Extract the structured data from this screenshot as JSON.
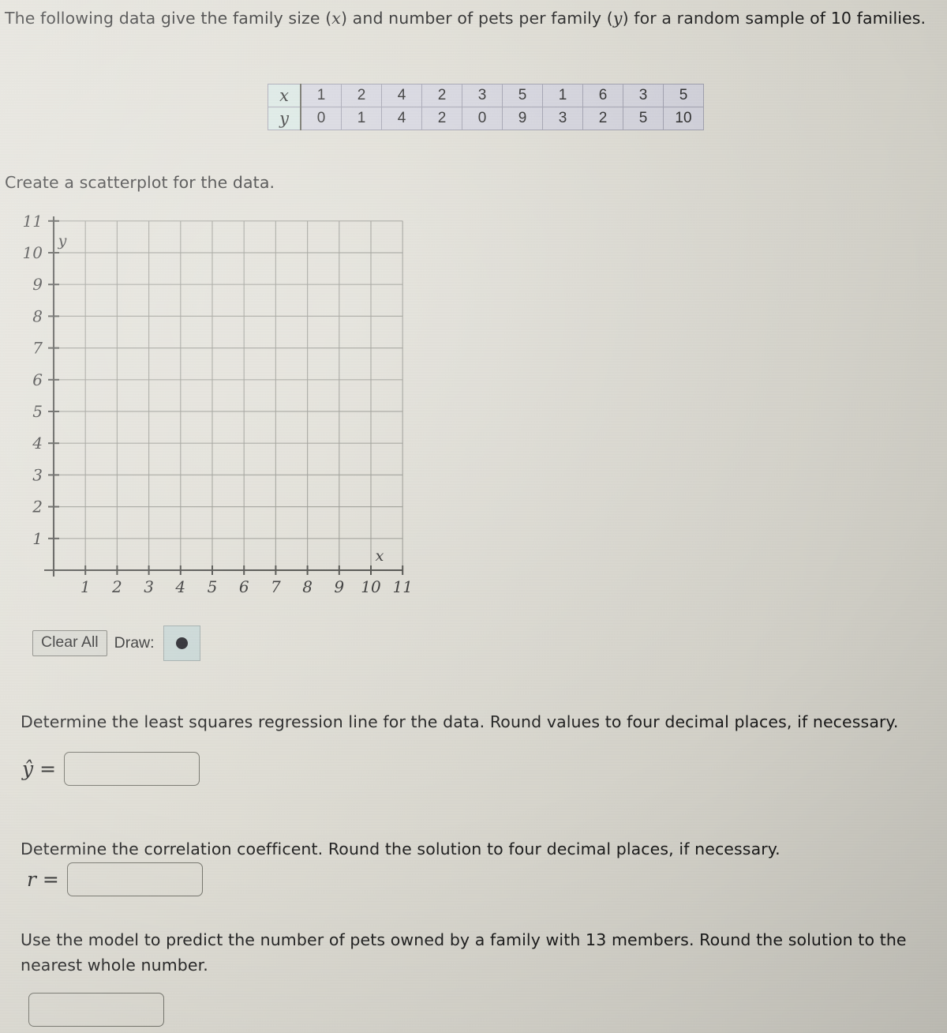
{
  "intro": {
    "text_before_x": "The following data give the family size (",
    "var_x": "x",
    "text_mid": ") and number of pets per family (",
    "var_y": "y",
    "text_after": ") for a random sample of 10 families."
  },
  "data_table": {
    "row_x_label": "x",
    "row_y_label": "y",
    "x_values": [
      "1",
      "2",
      "4",
      "2",
      "3",
      "5",
      "1",
      "6",
      "3",
      "5"
    ],
    "y_values": [
      "0",
      "1",
      "4",
      "2",
      "0",
      "9",
      "3",
      "2",
      "5",
      "10"
    ]
  },
  "scatterplot": {
    "instruction": "Create a scatterplot for the data.",
    "x_axis_label": "x",
    "y_axis_label": "y",
    "x_ticks": [
      "1",
      "2",
      "3",
      "4",
      "5",
      "6",
      "7",
      "8",
      "9",
      "10",
      "11"
    ],
    "y_ticks": [
      "1",
      "2",
      "3",
      "4",
      "5",
      "6",
      "7",
      "8",
      "9",
      "10",
      "11"
    ],
    "grid_color": "#8a8a82",
    "axis_color": "#3a3a36"
  },
  "toolbar": {
    "clear_all_label": "Clear All",
    "draw_label": "Draw:",
    "draw_tool_icon": "filled-dot",
    "draw_tool_color": "#111118",
    "draw_tool_background": "#c5d4d2"
  },
  "questions": {
    "regression": "Determine the least squares regression line for the data. Round values to four decimal places, if necessary.",
    "correlation": "Determine the correlation coefficent. Round the solution to four decimal places, if necessary.",
    "predict": "Use the model to predict the number of pets owned by a family with 13 members. Round the solution to the nearest whole number."
  },
  "answers": {
    "yhat_label": "ŷ =",
    "yhat_value": "",
    "r_label": "r =",
    "r_value": "",
    "predict_value": ""
  },
  "chart_data": {
    "type": "scatter",
    "title": "Create a scatterplot for the data.",
    "xlabel": "x",
    "ylabel": "y",
    "x": [
      1,
      2,
      4,
      2,
      3,
      5,
      1,
      6,
      3,
      5
    ],
    "y": [
      0,
      1,
      4,
      2,
      0,
      9,
      3,
      2,
      5,
      10
    ],
    "plotted_points": [],
    "xlim": [
      0,
      11
    ],
    "ylim": [
      0,
      11
    ],
    "xticks": [
      1,
      2,
      3,
      4,
      5,
      6,
      7,
      8,
      9,
      10,
      11
    ],
    "yticks": [
      1,
      2,
      3,
      4,
      5,
      6,
      7,
      8,
      9,
      10,
      11
    ],
    "grid": true,
    "legend": "none"
  }
}
